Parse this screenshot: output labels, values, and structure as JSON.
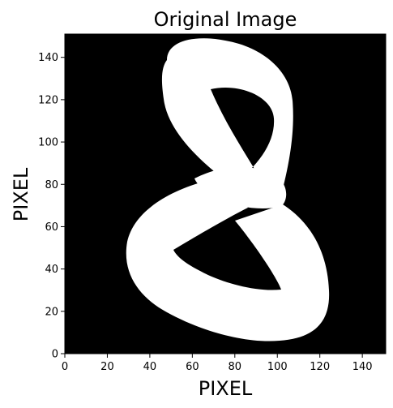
{
  "chart_data": {
    "type": "image",
    "title": "Original Image",
    "xlabel": "PIXEL",
    "ylabel": "PIXEL",
    "xlim": [
      0,
      151
    ],
    "ylim": [
      0,
      151
    ],
    "x_ticks": [
      0,
      20,
      40,
      60,
      80,
      100,
      120,
      140
    ],
    "y_ticks": [
      0,
      20,
      40,
      60,
      80,
      100,
      120,
      140
    ],
    "x_tick_labels": [
      "0",
      "20",
      "40",
      "60",
      "80",
      "100",
      "120",
      "140"
    ],
    "y_tick_labels": [
      "0",
      "20",
      "40",
      "60",
      "80",
      "100",
      "120",
      "140"
    ],
    "image_content": "handwritten digit 8",
    "colors": {
      "background": "#000000",
      "stroke": "#ffffff"
    }
  }
}
